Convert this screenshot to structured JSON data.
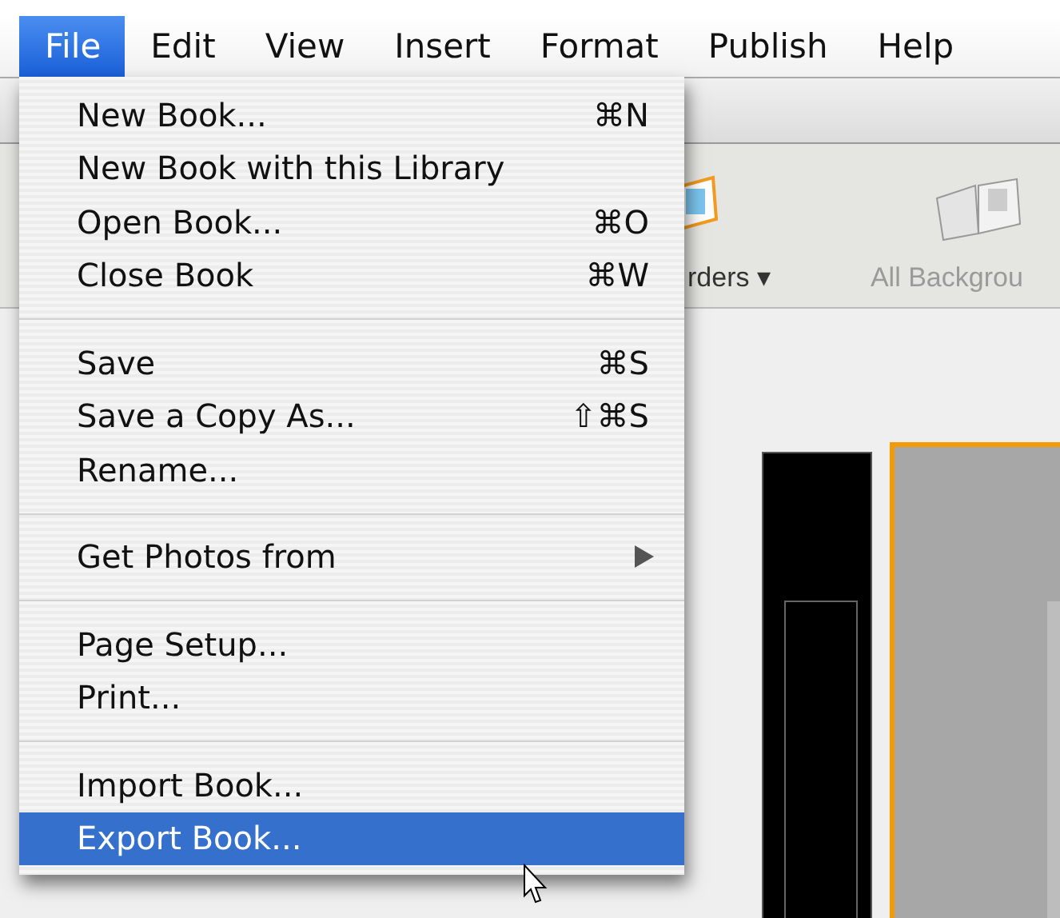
{
  "menu_bar": [
    {
      "label": "File",
      "selected": true
    },
    {
      "label": "Edit",
      "selected": false
    },
    {
      "label": "View",
      "selected": false
    },
    {
      "label": "Insert",
      "selected": false
    },
    {
      "label": "Format",
      "selected": false
    },
    {
      "label": "Publish",
      "selected": false
    },
    {
      "label": "Help",
      "selected": false
    }
  ],
  "file_menu": {
    "items": [
      {
        "kind": "item",
        "label": "New Book...",
        "shortcut": "⌘N",
        "submenu": false,
        "selected": false
      },
      {
        "kind": "item",
        "label": "New Book with this Library",
        "submenu": false,
        "selected": false
      },
      {
        "kind": "item",
        "label": "Open Book...",
        "shortcut": "⌘O",
        "submenu": false,
        "selected": false
      },
      {
        "kind": "item",
        "label": "Close Book",
        "shortcut": "⌘W",
        "submenu": false,
        "selected": false
      },
      {
        "kind": "separator"
      },
      {
        "kind": "item",
        "label": "Save",
        "shortcut": "⌘S",
        "submenu": false,
        "selected": false
      },
      {
        "kind": "item",
        "label": "Save a Copy As...",
        "shortcut": "⇧⌘S",
        "submenu": false,
        "selected": false
      },
      {
        "kind": "item",
        "label": "Rename...",
        "submenu": false,
        "selected": false
      },
      {
        "kind": "separator"
      },
      {
        "kind": "item",
        "label": "Get Photos from",
        "submenu": true,
        "selected": false
      },
      {
        "kind": "separator"
      },
      {
        "kind": "item",
        "label": "Page Setup...",
        "submenu": false,
        "selected": false
      },
      {
        "kind": "item",
        "label": "Print...",
        "submenu": false,
        "selected": false
      },
      {
        "kind": "separator"
      },
      {
        "kind": "item",
        "label": "Import Book...",
        "submenu": false,
        "selected": false
      },
      {
        "kind": "item",
        "label": "Export Book...",
        "submenu": false,
        "selected": true
      }
    ]
  },
  "toolbar": {
    "items": [
      {
        "kind": "borders",
        "label": "rders ▾"
      },
      {
        "kind": "backgrounds",
        "label": "All Backgrou"
      }
    ]
  }
}
